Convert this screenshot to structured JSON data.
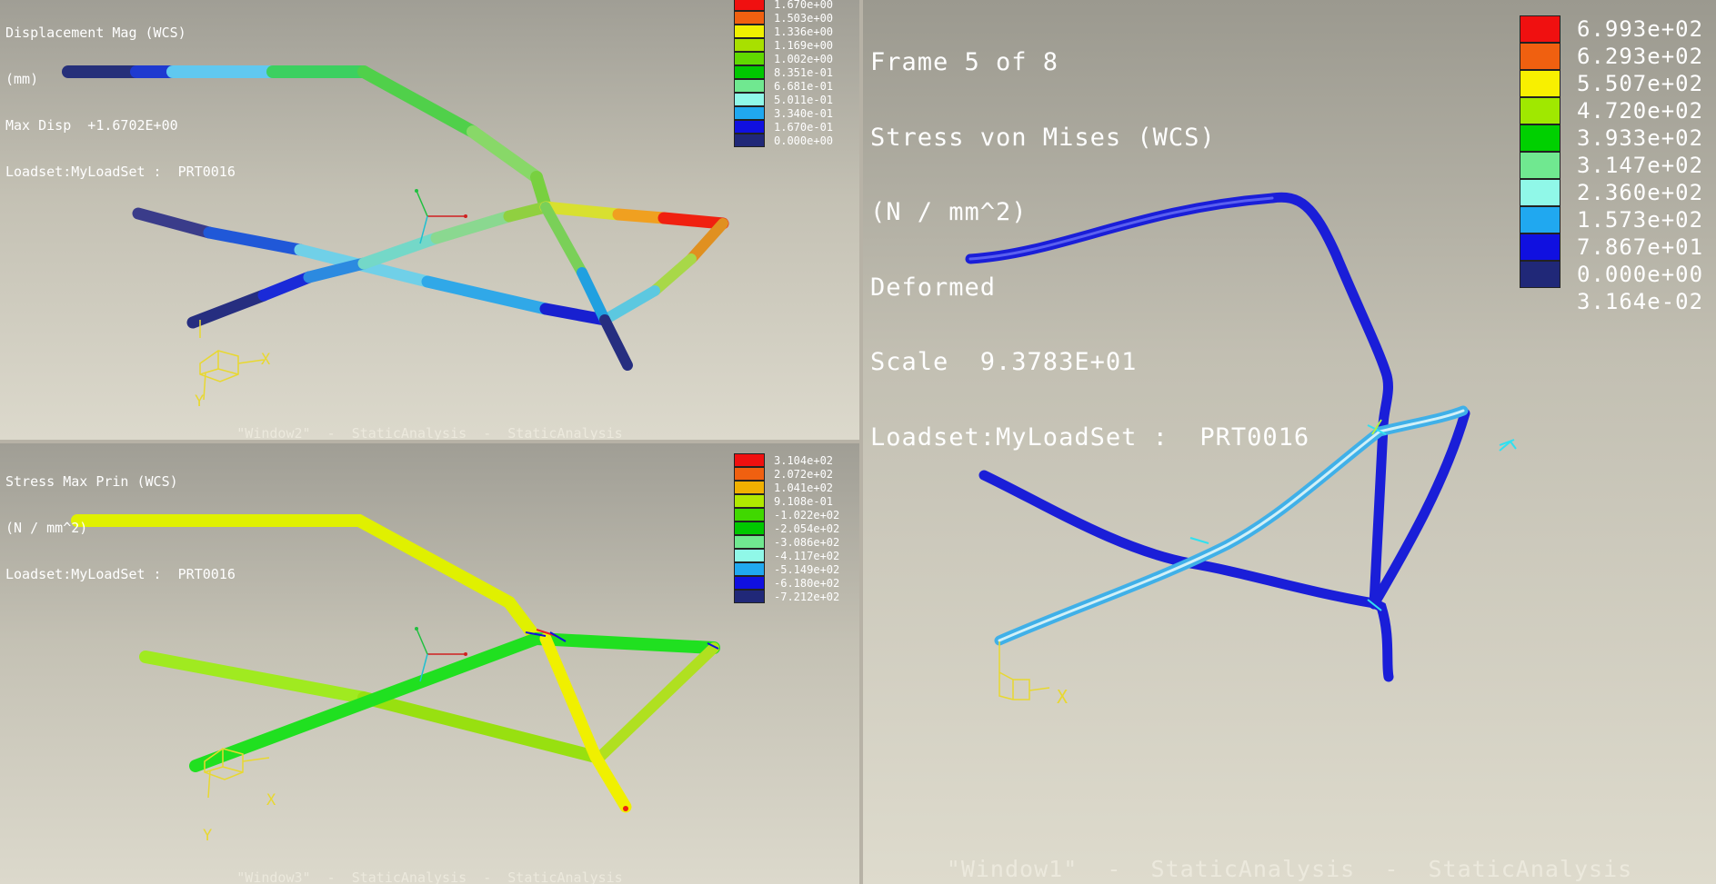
{
  "windows": {
    "window2": {
      "info_lines": [
        "Displacement Mag (WCS)",
        "(mm)",
        "Max Disp  +1.6702E+00",
        "Loadset:MyLoadSet :  PRT0016"
      ],
      "legend": [
        {
          "color": "#f01010",
          "value": "1.670e+00"
        },
        {
          "color": "#f06010",
          "value": "1.503e+00"
        },
        {
          "color": "#f0f000",
          "value": "1.336e+00"
        },
        {
          "color": "#a8e000",
          "value": "1.169e+00"
        },
        {
          "color": "#60d800",
          "value": "1.002e+00"
        },
        {
          "color": "#00c800",
          "value": "8.351e-01"
        },
        {
          "color": "#70e890",
          "value": "6.681e-01"
        },
        {
          "color": "#90f8e8",
          "value": "5.011e-01"
        },
        {
          "color": "#20a8f0",
          "value": "3.340e-01"
        },
        {
          "color": "#1010e0",
          "value": "1.670e-01"
        },
        {
          "color": "#202878",
          "value": "0.000e+00"
        }
      ],
      "footer": "\"Window2\"  -  StaticAnalysis  -  StaticAnalysis",
      "axis_labels": {
        "x": "X",
        "y": "Y"
      }
    },
    "window3": {
      "info_lines": [
        "Stress Max Prin (WCS)",
        "(N / mm^2)",
        "Loadset:MyLoadSet :  PRT0016"
      ],
      "legend": [
        {
          "color": "#f01010",
          "value": "3.104e+02"
        },
        {
          "color": "#f06010",
          "value": "2.072e+02"
        },
        {
          "color": "#f0b000",
          "value": "1.041e+02"
        },
        {
          "color": "#b0e800",
          "value": "9.108e-01"
        },
        {
          "color": "#40d800",
          "value": "-1.022e+02"
        },
        {
          "color": "#00c800",
          "value": "-2.054e+02"
        },
        {
          "color": "#70e890",
          "value": "-3.086e+02"
        },
        {
          "color": "#90f8e8",
          "value": "-4.117e+02"
        },
        {
          "color": "#20a8f0",
          "value": "-5.149e+02"
        },
        {
          "color": "#1010e0",
          "value": "-6.180e+02"
        },
        {
          "color": "#202878",
          "value": "-7.212e+02"
        }
      ],
      "footer": "\"Window3\"  -  StaticAnalysis  -  StaticAnalysis",
      "axis_labels": {
        "x": "X",
        "y": "Y"
      }
    },
    "window1": {
      "info_lines": [
        "Frame 5 of 8",
        "Stress von Mises (WCS)",
        "(N / mm^2)",
        "Deformed",
        "Scale  9.3783E+01",
        "Loadset:MyLoadSet :  PRT0016"
      ],
      "legend": [
        {
          "color": "#f01010",
          "value": "6.993e+02"
        },
        {
          "color": "#f06010",
          "value": "6.293e+02"
        },
        {
          "color": "#f8f000",
          "value": "5.507e+02"
        },
        {
          "color": "#a0e800",
          "value": "4.720e+02"
        },
        {
          "color": "#00d000",
          "value": "3.933e+02"
        },
        {
          "color": "#70e890",
          "value": "3.147e+02"
        },
        {
          "color": "#90f8e8",
          "value": "2.360e+02"
        },
        {
          "color": "#20a8f0",
          "value": "1.573e+02"
        },
        {
          "color": "#1010e0",
          "value": "7.867e+01"
        },
        {
          "color": "#202878",
          "value": "0.000e+00"
        },
        {
          "color": "#202878",
          "value": "3.164e-02"
        }
      ],
      "footer": "\"Window1\"  -  StaticAnalysis  -  StaticAnalysis",
      "axis_labels": {
        "x": "X"
      }
    }
  }
}
